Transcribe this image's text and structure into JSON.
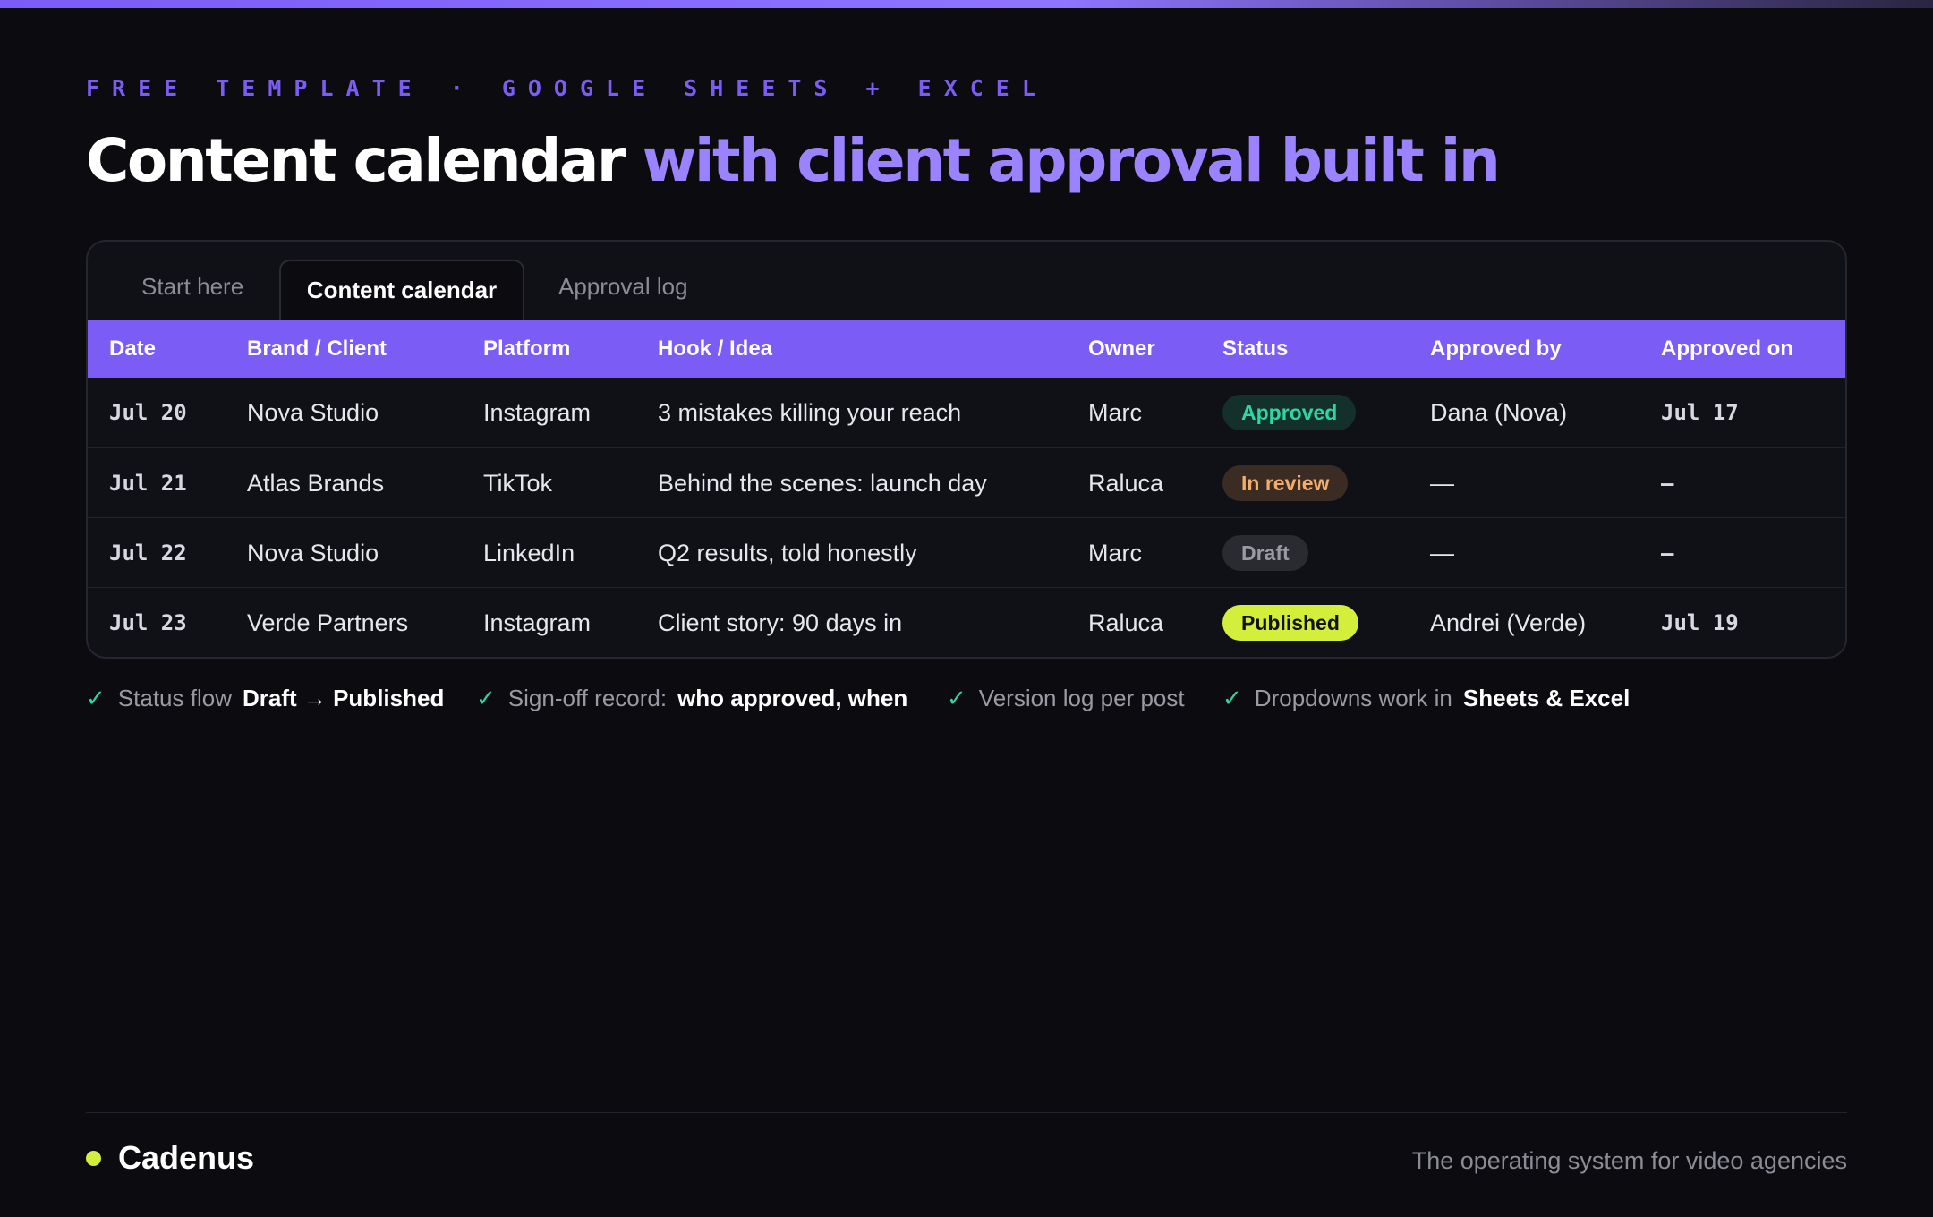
{
  "header": {
    "eyebrow": "FREE TEMPLATE · GOOGLE SHEETS + EXCEL",
    "headline_lead": "Content calendar",
    "headline_accent": "with client approval built in",
    "colors": {
      "accent": "#7b5cf5",
      "accent_light": "#9b82ff",
      "background": "#0b0b10"
    }
  },
  "tabs": [
    {
      "label": "Start here",
      "active": false
    },
    {
      "label": "Content calendar",
      "active": true
    },
    {
      "label": "Approval log",
      "active": false
    }
  ],
  "table": {
    "columns": [
      "Date",
      "Brand / Client",
      "Platform",
      "Hook / Idea",
      "Owner",
      "Status",
      "Approved by",
      "Approved on"
    ],
    "rows": [
      {
        "date": "Jul 20",
        "brand": "Nova Studio",
        "platform": "Instagram",
        "hook": "3 mistakes killing your reach",
        "owner": "Marc",
        "status": "Approved",
        "status_kind": "approved",
        "approved_by": "Dana (Nova)",
        "approved_on": "Jul 17"
      },
      {
        "date": "Jul 21",
        "brand": "Atlas Brands",
        "platform": "TikTok",
        "hook": "Behind the scenes: launch day",
        "owner": "Raluca",
        "status": "In review",
        "status_kind": "review",
        "approved_by": "—",
        "approved_on": "–"
      },
      {
        "date": "Jul 22",
        "brand": "Nova Studio",
        "platform": "LinkedIn",
        "hook": "Q2 results, told honestly",
        "owner": "Marc",
        "status": "Draft",
        "status_kind": "draft",
        "approved_by": "—",
        "approved_on": "–"
      },
      {
        "date": "Jul 23",
        "brand": "Verde Partners",
        "platform": "Instagram",
        "hook": "Client story: 90 days in",
        "owner": "Raluca",
        "status": "Published",
        "status_kind": "published",
        "approved_by": "Andrei (Verde)",
        "approved_on": "Jul 19"
      }
    ],
    "status_colors": {
      "approved": "#2fd6a0",
      "review": "#f2ad6c",
      "draft": "#9a9aa3",
      "published": "#d4ee3c"
    }
  },
  "features": [
    {
      "icon": "check-icon",
      "check": "✓",
      "text": "Status flow",
      "bold": "Draft → Published"
    },
    {
      "icon": "check-icon",
      "check": "✓",
      "text": "Sign-off record:",
      "bold": "who approved, when"
    },
    {
      "icon": "check-icon",
      "check": "✓",
      "text": "Version log per post",
      "bold": ""
    },
    {
      "icon": "check-icon",
      "check": "✓",
      "text": "Dropdowns work in",
      "bold": "Sheets & Excel"
    }
  ],
  "footer": {
    "brand": "Cadenus",
    "brand_dot_color": "#d4ee3c",
    "tagline": "The operating system for video agencies"
  }
}
